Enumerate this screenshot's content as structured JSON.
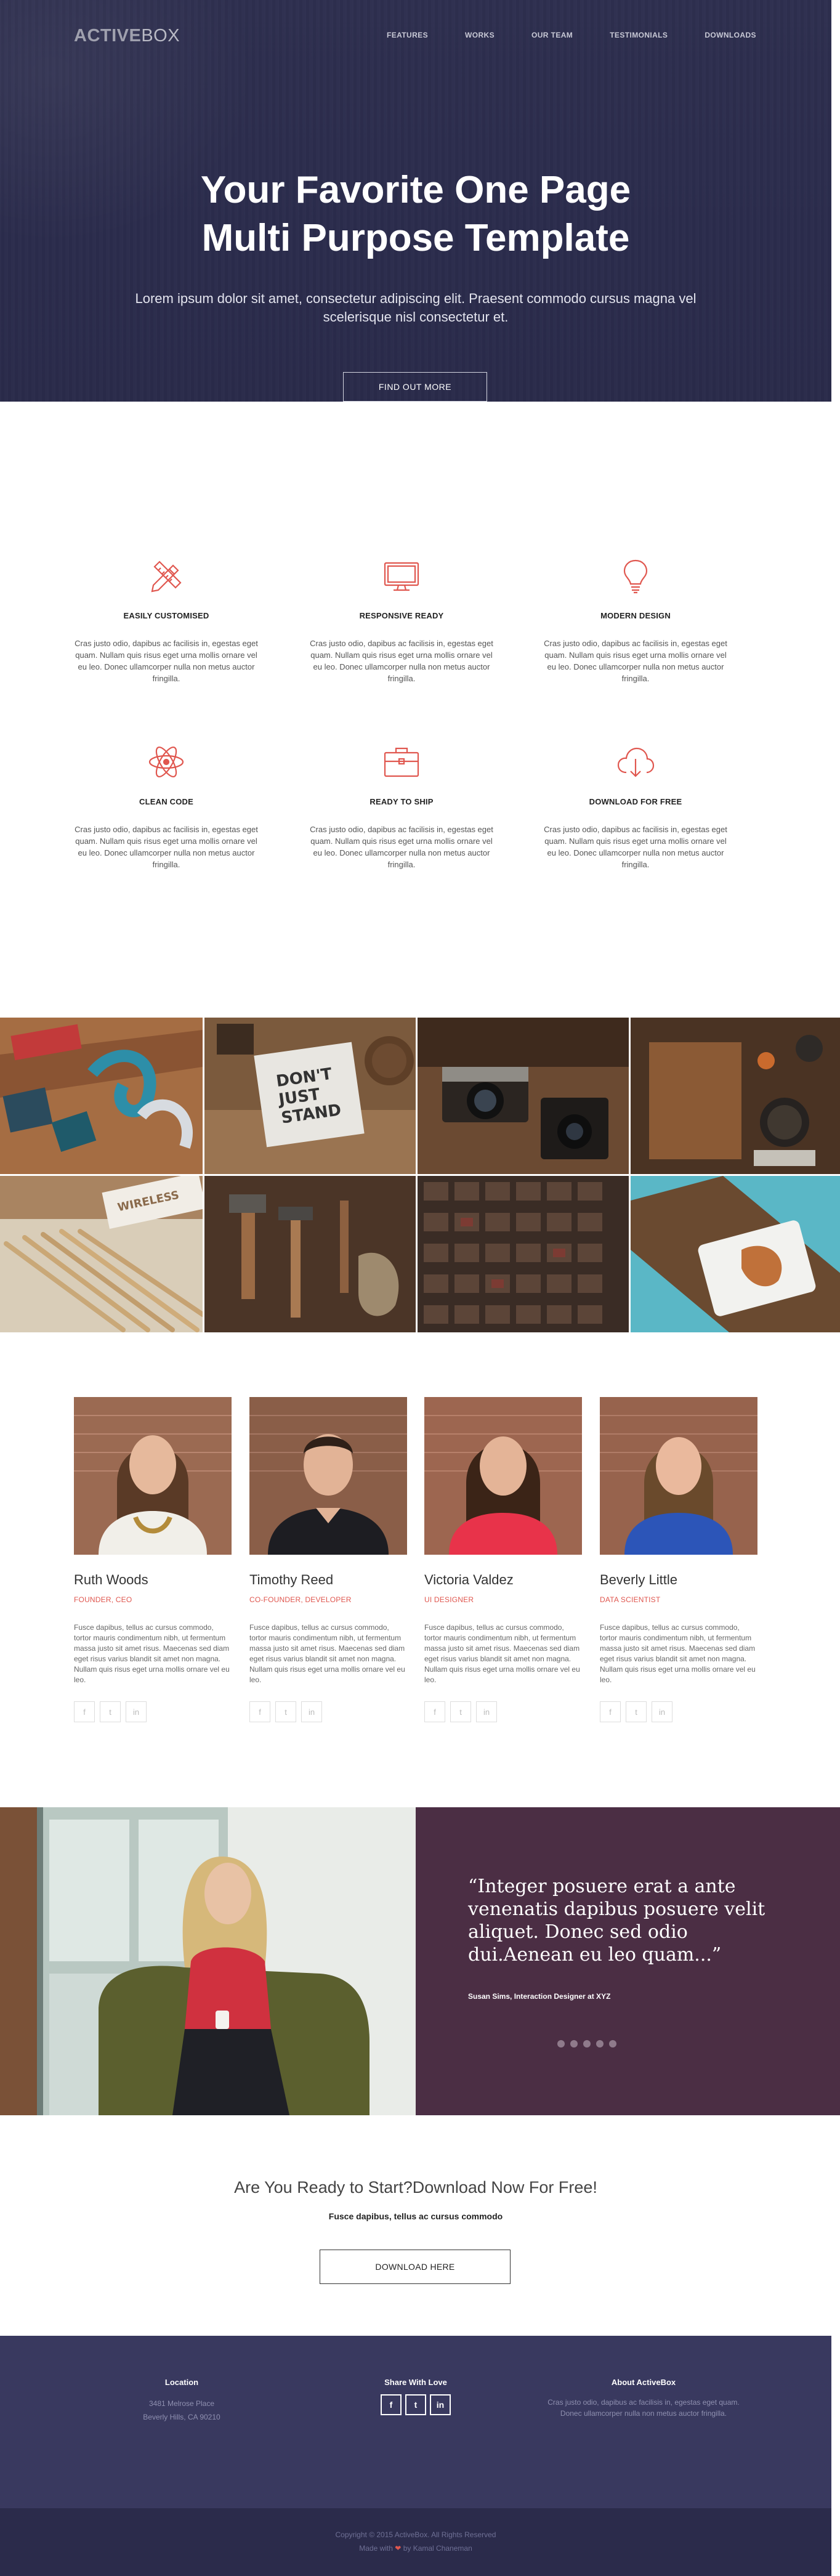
{
  "brand": {
    "logo_bold": "ACTIVE",
    "logo_light": "BOX"
  },
  "nav": [
    "FEATURES",
    "WORKS",
    "OUR TEAM",
    "TESTIMONIALS",
    "DOWNLOADS"
  ],
  "hero": {
    "title_line1": "Your Favorite One Page",
    "title_line2": "Multi Purpose Template",
    "subtitle": "Lorem ipsum dolor sit amet, consectetur adipiscing elit. Praesent commodo cursus magna vel scelerisque nisl consectetur et.",
    "button": "FIND OUT MORE"
  },
  "features": [
    {
      "icon": "pencil-ruler-icon",
      "title": "EASILY CUSTOMISED",
      "text": "Cras justo odio, dapibus ac facilisis in, egestas eget quam. Nullam quis risus eget urna mollis ornare vel eu leo. Donec ullamcorper nulla non metus auctor fringilla."
    },
    {
      "icon": "monitor-icon",
      "title": "RESPONSIVE READY",
      "text": "Cras justo odio, dapibus ac facilisis in, egestas eget quam. Nullam quis risus eget urna mollis ornare vel eu leo. Donec ullamcorper nulla non metus auctor fringilla."
    },
    {
      "icon": "lightbulb-icon",
      "title": "MODERN DESIGN",
      "text": "Cras justo odio, dapibus ac facilisis in, egestas eget quam. Nullam quis risus eget urna mollis ornare vel eu leo. Donec ullamcorper nulla non metus auctor fringilla."
    },
    {
      "icon": "atom-icon",
      "title": "CLEAN CODE",
      "text": "Cras justo odio, dapibus ac facilisis in, egestas eget quam. Nullam quis risus eget urna mollis ornare vel eu leo. Donec ullamcorper nulla non metus auctor fringilla."
    },
    {
      "icon": "briefcase-icon",
      "title": "READY TO SHIP",
      "text": "Cras justo odio, dapibus ac facilisis in, egestas eget quam. Nullam quis risus eget urna mollis ornare vel eu leo. Donec ullamcorper nulla non metus auctor fringilla."
    },
    {
      "icon": "cloud-download-icon",
      "title": "DOWNLOAD FOR FREE",
      "text": "Cras justo odio, dapibus ac facilisis in, egestas eget quam. Nullam quis risus eget urna mollis ornare vel eu leo. Donec ullamcorper nulla non metus auctor fringilla."
    }
  ],
  "gallery": [
    {
      "name": "gallery-tile-stationery"
    },
    {
      "name": "gallery-tile-dont-stand-there"
    },
    {
      "name": "gallery-tile-cameras"
    },
    {
      "name": "gallery-tile-cutting-board"
    },
    {
      "name": "gallery-tile-pencils"
    },
    {
      "name": "gallery-tile-tools"
    },
    {
      "name": "gallery-tile-letterpress"
    },
    {
      "name": "gallery-tile-food-plate"
    }
  ],
  "team": [
    {
      "name": "Ruth Woods",
      "role": "FOUNDER, CEO",
      "bio": "Fusce dapibus, tellus ac cursus commodo, tortor mauris condimentum nibh, ut fermentum massa justo sit amet risus. Maecenas sed diam eget risus varius blandit sit amet non magna. Nullam quis risus eget urna mollis ornare vel eu leo."
    },
    {
      "name": "Timothy Reed",
      "role": "CO-FOUNDER, DEVELOPER",
      "bio": "Fusce dapibus, tellus ac cursus commodo, tortor mauris condimentum nibh, ut fermentum massa justo sit amet risus. Maecenas sed diam eget risus varius blandit sit amet non magna. Nullam quis risus eget urna mollis ornare vel eu leo."
    },
    {
      "name": "Victoria Valdez",
      "role": "UI DESIGNER",
      "bio": "Fusce dapibus, tellus ac cursus commodo, tortor mauris condimentum nibh, ut fermentum massa justo sit amet risus. Maecenas sed diam eget risus varius blandit sit amet non magna. Nullam quis risus eget urna mollis ornare vel eu leo."
    },
    {
      "name": "Beverly Little",
      "role": "DATA SCIENTIST",
      "bio": "Fusce dapibus, tellus ac cursus commodo, tortor mauris condimentum nibh, ut fermentum massa justo sit amet risus. Maecenas sed diam eget risus varius blandit sit amet non magna. Nullam quis risus eget urna mollis ornare vel eu leo."
    }
  ],
  "social_glyphs": {
    "facebook": "f",
    "twitter": "t",
    "linkedin": "in"
  },
  "testimonial": {
    "quote": "“Integer posuere erat a ante venenatis dapibus posuere velit aliquet. Donec sed odio dui.Aenean eu leo quam...”",
    "author": "Susan Sims, Interaction Designer at XYZ"
  },
  "cta": {
    "title": "Are You Ready to Start?Download Now For Free!",
    "subtitle": "Fusce dapibus, tellus ac cursus commodo",
    "button": "DOWNLOAD HERE"
  },
  "footer": {
    "location_title": "Location",
    "address_line1": "3481 Melrose Place",
    "address_line2": "Beverly Hills, CA 90210",
    "share_title": "Share With Love",
    "about_title": "About ActiveBox",
    "about_text": "Cras justo odio, dapibus ac facilisis in, egestas eget quam. Donec ullamcorper nulla non metus auctor fringilla.",
    "copyright": "Copyright © 2015 ActiveBox. All Rights Reserved",
    "made_with_prefix": "Made with",
    "heart": "❤",
    "made_with_suffix": "by Kamal Chaneman"
  },
  "colors": {
    "accent": "#e0574f",
    "hero_bg": "#2e2f4f",
    "testimonial_bg": "#4b2e44",
    "footer_bg": "#39395f"
  }
}
